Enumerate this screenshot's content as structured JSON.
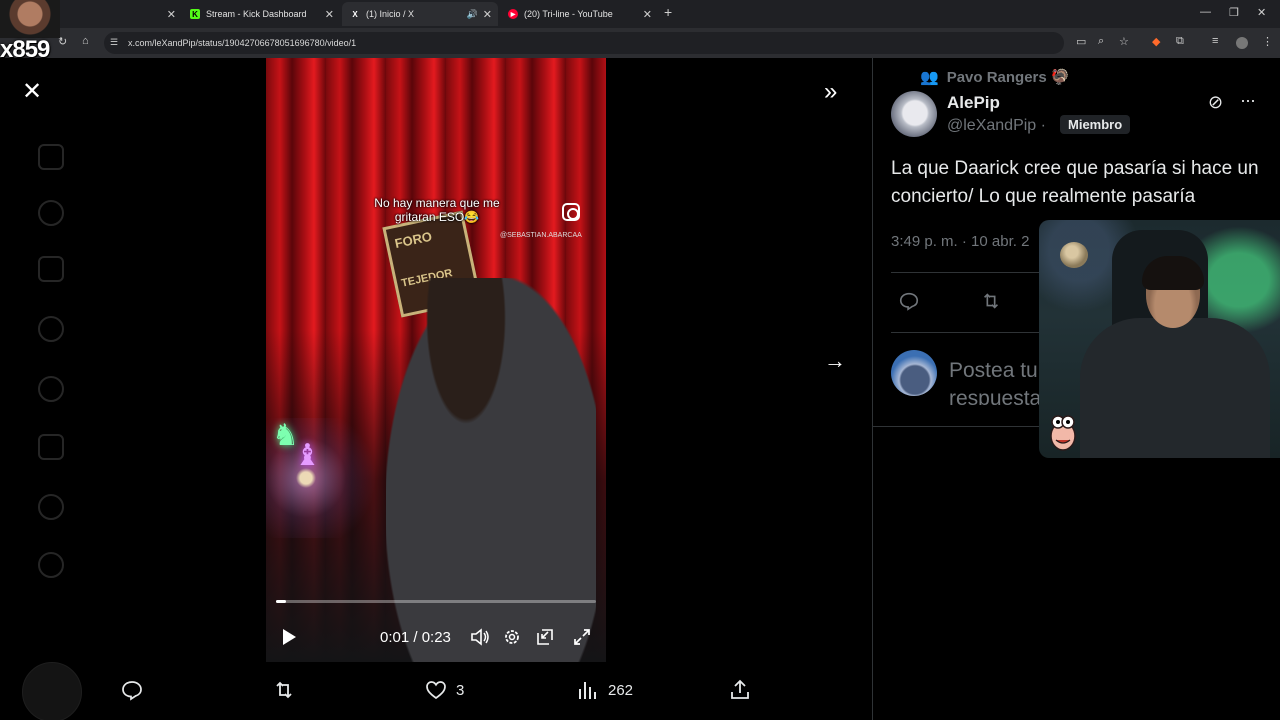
{
  "browser": {
    "tabs": [
      {
        "title": "",
        "favicon": ""
      },
      {
        "title": "Stream - Kick Dashboard",
        "favicon": "K"
      },
      {
        "title": "(1) Inicio / X",
        "favicon": "X"
      },
      {
        "title": "(20) Tri-line - YouTube",
        "favicon": "▶"
      }
    ],
    "url": "x.com/leXandPip/status/1904270667805169678​0/video/1"
  },
  "overlay": {
    "streamer_tag": "x859"
  },
  "video": {
    "caption": "No hay manera que me gritaran ESO😂",
    "watermark": "@SEBASTIAN.ABARCAA",
    "sign_top": "FORO",
    "sign_bottom": "TEJEDOR",
    "time": "0:01 / 0:23",
    "progress_fraction": 0.03
  },
  "actions": {
    "likes": "3",
    "views": "262"
  },
  "tweet": {
    "community": "Pavo Rangers",
    "author": "AlePip",
    "handle": "@leXandPip ·",
    "member_badge": "Miembro",
    "text": "La que Daarick cree que pasaría si hace un concierto/ Lo que realmente pasaría",
    "timestamp": "3:49 p. m. · 10 abr. 2",
    "reply_placeholder": "Postea tu respuesta"
  },
  "colors": {
    "background": "#000000",
    "muted": "#71767b",
    "text": "#e7e9ea",
    "border": "#2f3336"
  }
}
